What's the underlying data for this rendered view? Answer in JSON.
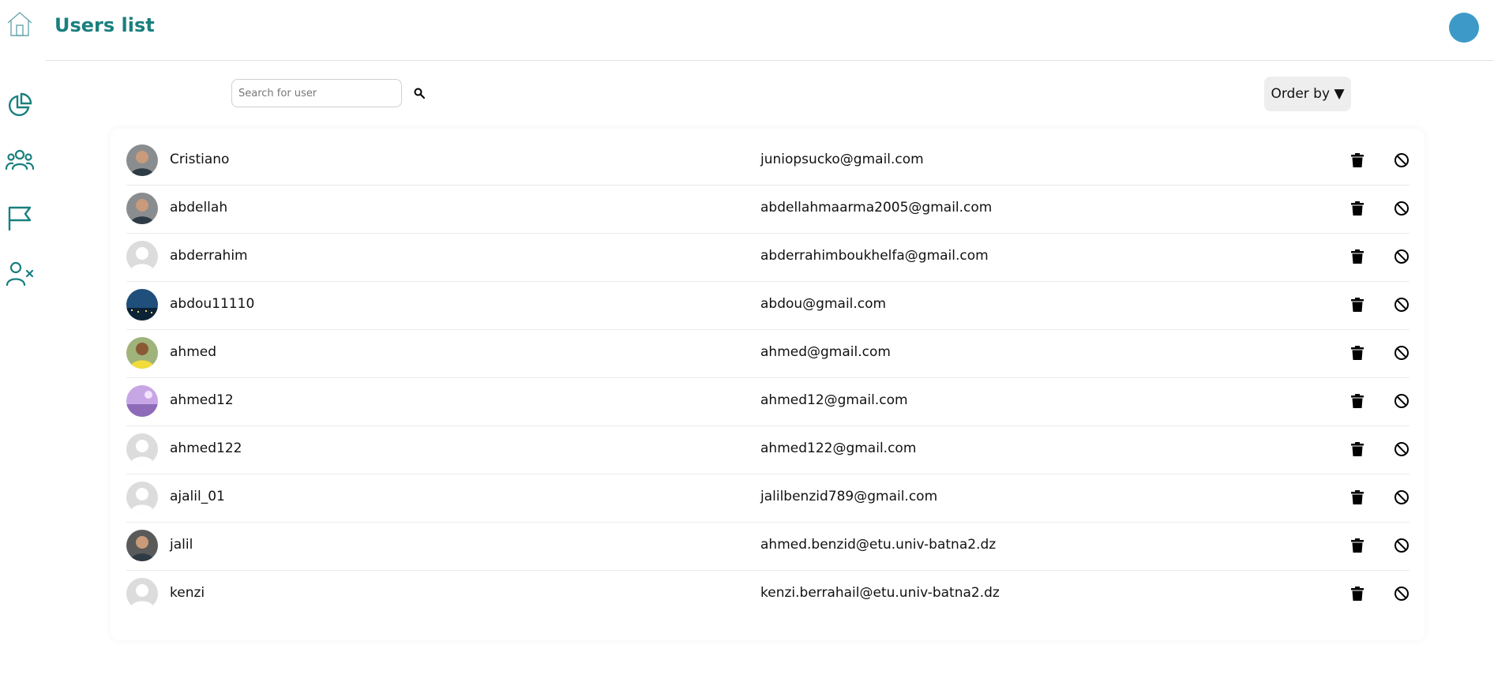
{
  "header": {
    "title": "Users list"
  },
  "sidebar": {
    "icons": [
      "home-icon",
      "pie-chart-icon",
      "users-icon",
      "flag-icon",
      "user-x-icon"
    ],
    "accent_color": "#1a7f7f"
  },
  "toolbar": {
    "search_placeholder": "Search for user",
    "search_value": "",
    "order_label": "Order by ▼"
  },
  "users": [
    {
      "name": "Cristiano",
      "email": "juniopsucko@gmail.com",
      "avatar": "photo-man-gray"
    },
    {
      "name": "abdellah",
      "email": "abdellahmaarma2005@gmail.com",
      "avatar": "photo-man-gray"
    },
    {
      "name": "abderrahim",
      "email": "abderrahimboukhelfa@gmail.com",
      "avatar": "default"
    },
    {
      "name": "abdou11110",
      "email": "abdou@gmail.com",
      "avatar": "photo-city-night"
    },
    {
      "name": "ahmed",
      "email": "ahmed@gmail.com",
      "avatar": "photo-yellow-jersey"
    },
    {
      "name": "ahmed12",
      "email": "ahmed12@gmail.com",
      "avatar": "photo-purple-sky"
    },
    {
      "name": "ahmed122",
      "email": "ahmed122@gmail.com",
      "avatar": "default"
    },
    {
      "name": "ajalil_01",
      "email": "jalilbenzid789@gmail.com",
      "avatar": "default"
    },
    {
      "name": "jalil",
      "email": "ahmed.benzid@etu.univ-batna2.dz",
      "avatar": "photo-man-dark"
    },
    {
      "name": "kenzi",
      "email": "kenzi.berrahail@etu.univ-batna2.dz",
      "avatar": "default"
    }
  ],
  "colors": {
    "accent": "#1a7f7f",
    "profile_avatar": "#3d9ac8"
  }
}
